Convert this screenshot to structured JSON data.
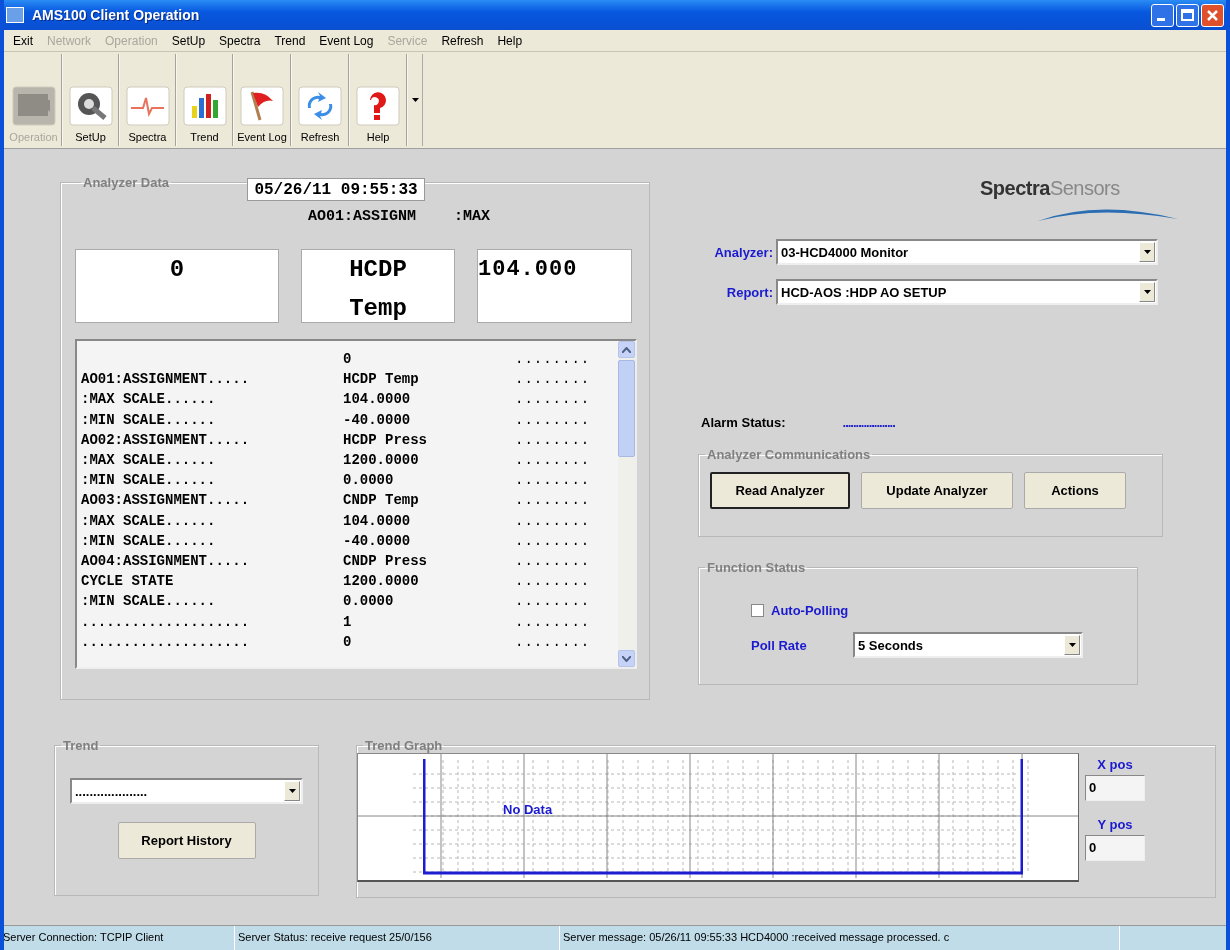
{
  "window": {
    "title": "AMS100 Client Operation"
  },
  "menu": [
    {
      "label": "Exit",
      "disabled": false
    },
    {
      "label": "Network",
      "disabled": true
    },
    {
      "label": "Operation",
      "disabled": true
    },
    {
      "label": "SetUp",
      "disabled": false
    },
    {
      "label": "Spectra",
      "disabled": false
    },
    {
      "label": "Trend",
      "disabled": false
    },
    {
      "label": "Event Log",
      "disabled": false
    },
    {
      "label": "Service",
      "disabled": true
    },
    {
      "label": "Refresh",
      "disabled": false
    },
    {
      "label": "Help",
      "disabled": false
    }
  ],
  "toolbar": [
    {
      "label": "Operation",
      "disabled": true
    },
    {
      "label": "SetUp",
      "disabled": false
    },
    {
      "label": "Spectra",
      "disabled": false
    },
    {
      "label": "Trend",
      "disabled": false
    },
    {
      "label": "Event Log",
      "disabled": false
    },
    {
      "label": "Refresh",
      "disabled": false
    },
    {
      "label": "Help",
      "disabled": false
    }
  ],
  "analyzer_data": {
    "title": "Analyzer Data",
    "timestamp": "05/26/11 09:55:33",
    "header_labels": [
      "AO01:ASSIGNM",
      ":MAX"
    ],
    "value_boxes": [
      [
        "0"
      ],
      [
        "HCDP",
        "Temp"
      ],
      [
        "104.000"
      ]
    ],
    "rows": [
      {
        "label": "",
        "value": "0",
        "filler": "........"
      },
      {
        "label": "AO01:ASSIGNMENT.....",
        "value": "HCDP Temp",
        "filler": "........"
      },
      {
        "label": ":MAX SCALE......",
        "value": "104.0000",
        "filler": "........"
      },
      {
        "label": ":MIN SCALE......",
        "value": "-40.0000",
        "filler": "........"
      },
      {
        "label": "AO02:ASSIGNMENT.....",
        "value": "HCDP Press",
        "filler": "........"
      },
      {
        "label": ":MAX SCALE......",
        "value": "1200.0000",
        "filler": "........"
      },
      {
        "label": ":MIN SCALE......",
        "value": "0.0000",
        "filler": "........"
      },
      {
        "label": "AO03:ASSIGNMENT.....",
        "value": "CNDP Temp",
        "filler": "........"
      },
      {
        "label": ":MAX SCALE......",
        "value": "104.0000",
        "filler": "........"
      },
      {
        "label": ":MIN SCALE......",
        "value": "-40.0000",
        "filler": "........"
      },
      {
        "label": "AO04:ASSIGNMENT.....",
        "value": "CNDP Press",
        "filler": "........"
      },
      {
        "label": "CYCLE STATE",
        "value": "1200.0000",
        "filler": "........"
      },
      {
        "label": ":MIN SCALE......",
        "value": "0.0000",
        "filler": "........"
      },
      {
        "label": "....................",
        "value": "1",
        "filler": "........"
      },
      {
        "label": "....................",
        "value": "0",
        "filler": "........"
      }
    ]
  },
  "logo": {
    "part_1": "Spectra",
    "part_2": "Sensors"
  },
  "analyzer": {
    "label": "Analyzer:",
    "value": "03-HCD4000 Monitor"
  },
  "report": {
    "label": "Report:",
    "value": "HCD-AOS :HDP AO SETUP"
  },
  "alarm_status": {
    "label": "Alarm Status:",
    "value": "...................."
  },
  "communications": {
    "title": "Analyzer Communications",
    "buttons": [
      {
        "label": "Read Analyzer",
        "default": true
      },
      {
        "label": "Update Analyzer",
        "default": false
      },
      {
        "label": "Actions",
        "default": false
      }
    ]
  },
  "function_status": {
    "title": "Function Status",
    "auto_polling": {
      "label": "Auto-Polling",
      "checked": false
    },
    "poll_rate": {
      "label": "Poll Rate",
      "value": "5 Seconds"
    }
  },
  "trend": {
    "title": "Trend",
    "select_value": "....................",
    "button": "Report History"
  },
  "trend_graph": {
    "title": "Trend Graph",
    "message": "No Data",
    "x_pos": {
      "label": "X pos",
      "value": "0"
    },
    "y_pos": {
      "label": "Y pos",
      "value": "0"
    }
  },
  "status_bar": [
    "Server Connection: TCPIP Client",
    "Server Status: receive request 25/0/156",
    "Server message: 05/26/11 09:55:33 HCD4000 :received message processed.  c"
  ]
}
